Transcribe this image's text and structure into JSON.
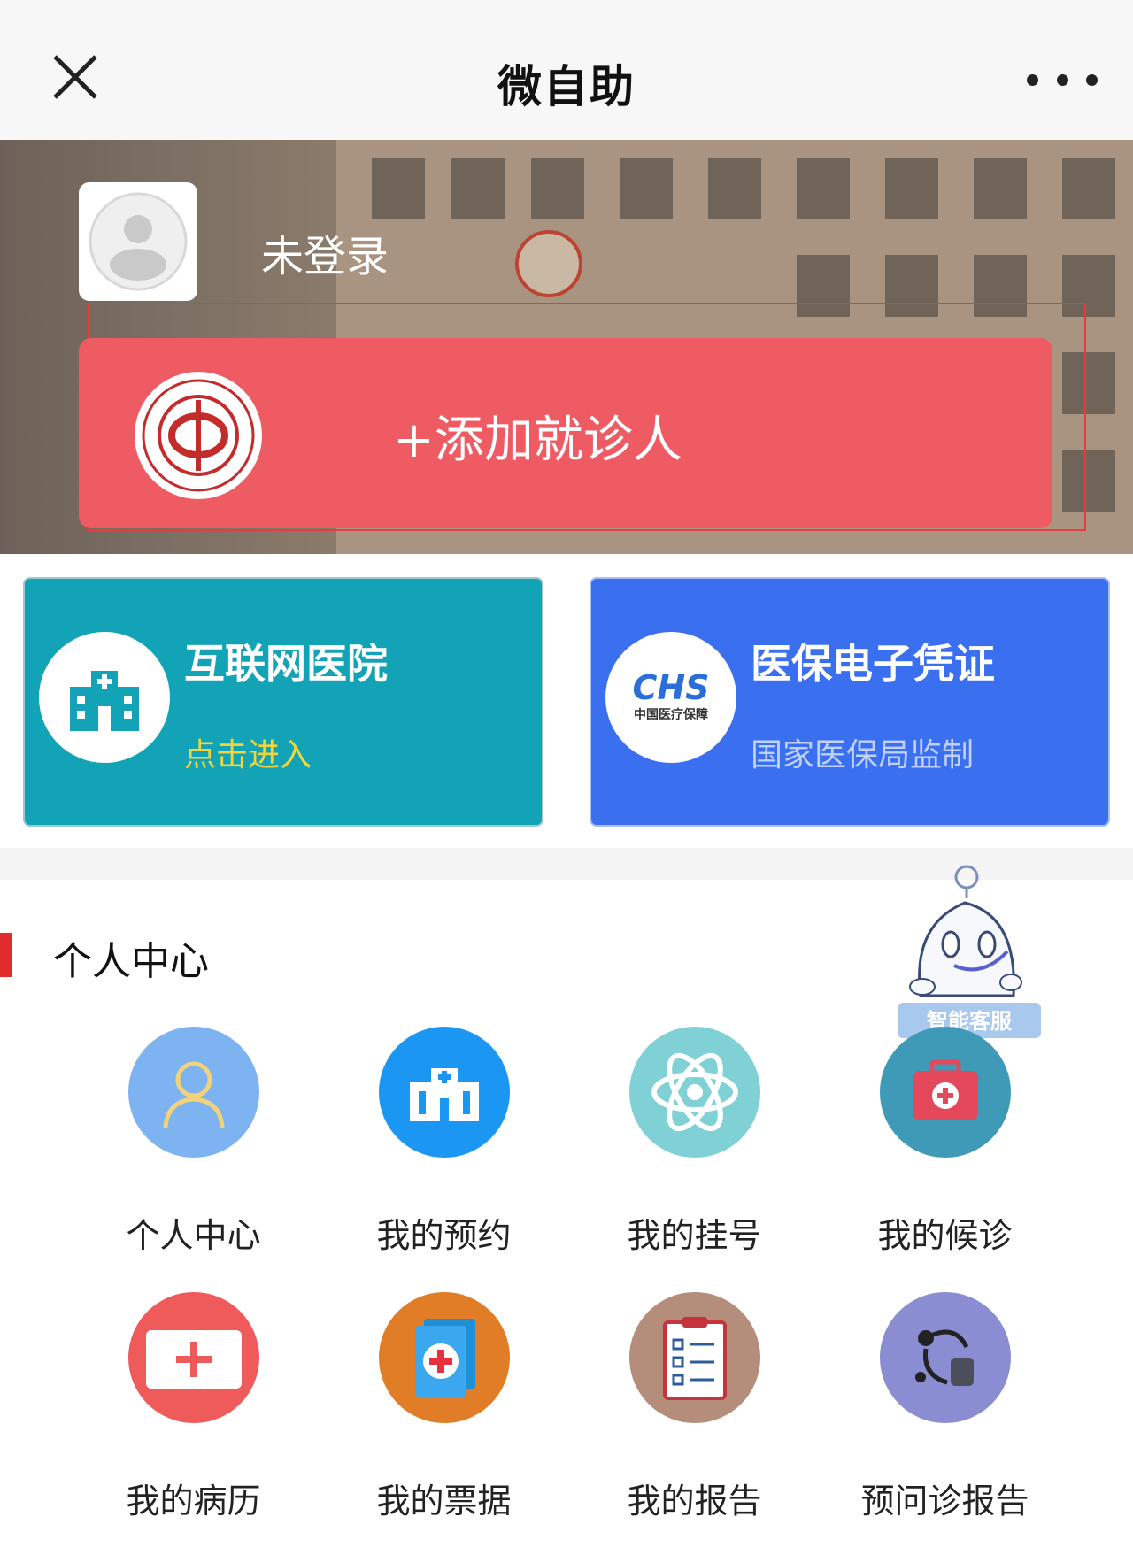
{
  "header": {
    "title": "微自助"
  },
  "banner": {
    "login_status": "未登录",
    "add_patient_label": "+添加就诊人"
  },
  "cards": {
    "internet": {
      "title": "互联网医院",
      "subtitle": "点击进入"
    },
    "insurance": {
      "title": "医保电子凭证",
      "subtitle": "国家医保局监制",
      "logo_text": "CHS",
      "logo_caption": "中国医疗保障"
    }
  },
  "section": {
    "title": "个人中心"
  },
  "grid": {
    "items": [
      {
        "label": "个人中心",
        "icon": "person-icon",
        "color": "#7db3f0"
      },
      {
        "label": "我的预约",
        "icon": "hospital-building-icon",
        "color": "#1c96f3"
      },
      {
        "label": "我的挂号",
        "icon": "atom-icon",
        "color": "#7fd1d6"
      },
      {
        "label": "我的候诊",
        "icon": "first-aid-kit-icon",
        "color": "#3e9ab7"
      },
      {
        "label": "我的病历",
        "icon": "medical-card-icon",
        "color": "#ef5b5b"
      },
      {
        "label": "我的票据",
        "icon": "medical-book-icon",
        "color": "#e07d26"
      },
      {
        "label": "我的报告",
        "icon": "clipboard-icon",
        "color": "#b48e7a"
      },
      {
        "label": "预问诊报告",
        "icon": "stethoscope-icon",
        "color": "#8a8dd1"
      }
    ]
  },
  "chatbot": {
    "label": "智能客服"
  },
  "colors": {
    "accent_red": "#ef5b62",
    "teal": "#13a3b7",
    "blue": "#3a6fef",
    "section_bar": "#e02c2c"
  }
}
